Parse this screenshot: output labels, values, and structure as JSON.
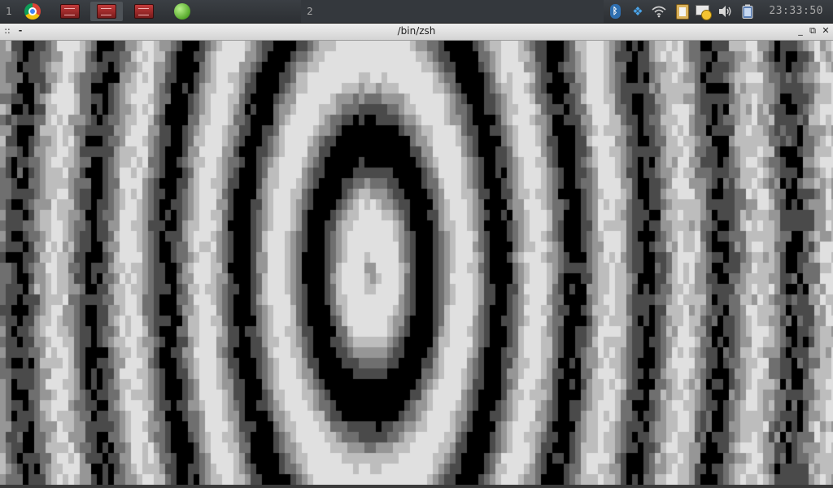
{
  "panel": {
    "workspaces": [
      {
        "label": "1"
      },
      {
        "label": "2"
      }
    ],
    "tasks": [
      {
        "icon": "chrome-icon",
        "active": false
      },
      {
        "icon": "terminal-app-icon",
        "active": false
      },
      {
        "icon": "terminal-app-icon",
        "active": true
      },
      {
        "icon": "terminal-app-icon",
        "active": false
      },
      {
        "icon": "green-ball-icon",
        "active": false
      }
    ],
    "tray": [
      "bluetooth-icon",
      "dropbox-icon",
      "wifi-icon",
      "clipboard-icon",
      "mail-notify-icon",
      "volume-icon",
      "battery-icon"
    ],
    "clock": "23:33:50"
  },
  "window": {
    "title": "/bin/zsh",
    "grip_glyph": "::",
    "menu_glyph": "-",
    "min_glyph": "_",
    "max_glyph": "⧉",
    "close_glyph": "✕"
  },
  "terminal": {
    "palette": [
      "#000000",
      "#4a4a4a",
      "#6f6f6f",
      "#969696",
      "#bdbdbd",
      "#e0e0e0"
    ]
  }
}
